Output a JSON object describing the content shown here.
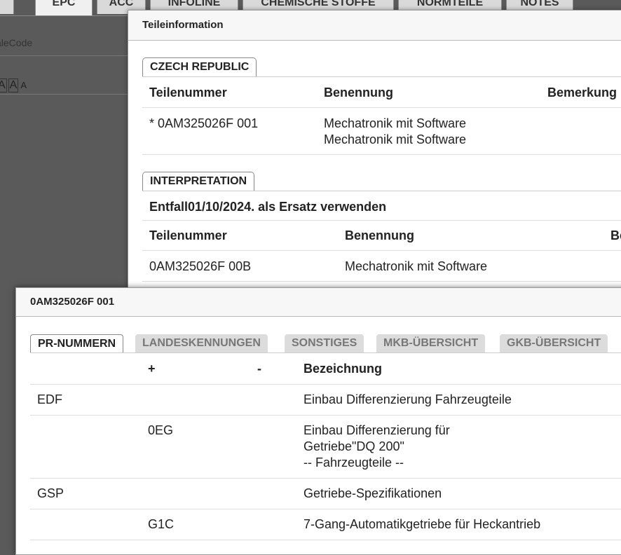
{
  "background": {
    "tabs": [
      "EPC",
      "ACC",
      "INFOLINE",
      "CHEMISCHE STOFFE",
      "NORMTEILE",
      "NOTES"
    ],
    "input_placeholder": "aleCode",
    "font_buttons": [
      "A",
      "A",
      "A"
    ]
  },
  "parts_dialog": {
    "title": "Teileinformation",
    "section1": {
      "label": "CZECH REPUBLIC",
      "headers": [
        "Teilenummer",
        "Benennung",
        "Bemerkung"
      ],
      "rows": [
        {
          "part": "* 0AM325026F 001",
          "name_line1": "Mechatronik mit Software",
          "name_line2": "Mechatronik mit Software"
        }
      ]
    },
    "section2": {
      "label": "INTERPRETATION",
      "note": "Entfall01/10/2024. als Ersatz verwenden",
      "headers": [
        "Teilenummer",
        "Benennung",
        "Be"
      ],
      "rows": [
        {
          "part": "0AM325026F 00B",
          "name": "Mechatronik mit Software"
        }
      ]
    }
  },
  "detail_dialog": {
    "title": "0AM325026F 001",
    "tabs": [
      "PR-NUMMERN",
      "LANDESKENNUNGEN",
      "SONSTIGES",
      "MKB-ÜBERSICHT",
      "GKB-ÜBERSICHT"
    ],
    "headers": {
      "plus": "+",
      "minus": "-",
      "desc": "Bezeichnung"
    },
    "rows": [
      {
        "family": "EDF",
        "plus": "",
        "desc_lines": [
          "Einbau Differenzierung Fahrzeugteile"
        ]
      },
      {
        "family": "",
        "plus": "0EG",
        "desc_lines": [
          "Einbau Differenzierung für",
          "Getriebe\"DQ 200\"",
          "-- Fahrzeugteile --"
        ]
      },
      {
        "family": "GSP",
        "plus": "",
        "desc_lines": [
          "Getriebe-Spezifikationen"
        ]
      },
      {
        "family": "",
        "plus": "G1C",
        "desc_lines": [
          "7-Gang-Automatikgetriebe für Heckantrieb"
        ]
      }
    ]
  }
}
